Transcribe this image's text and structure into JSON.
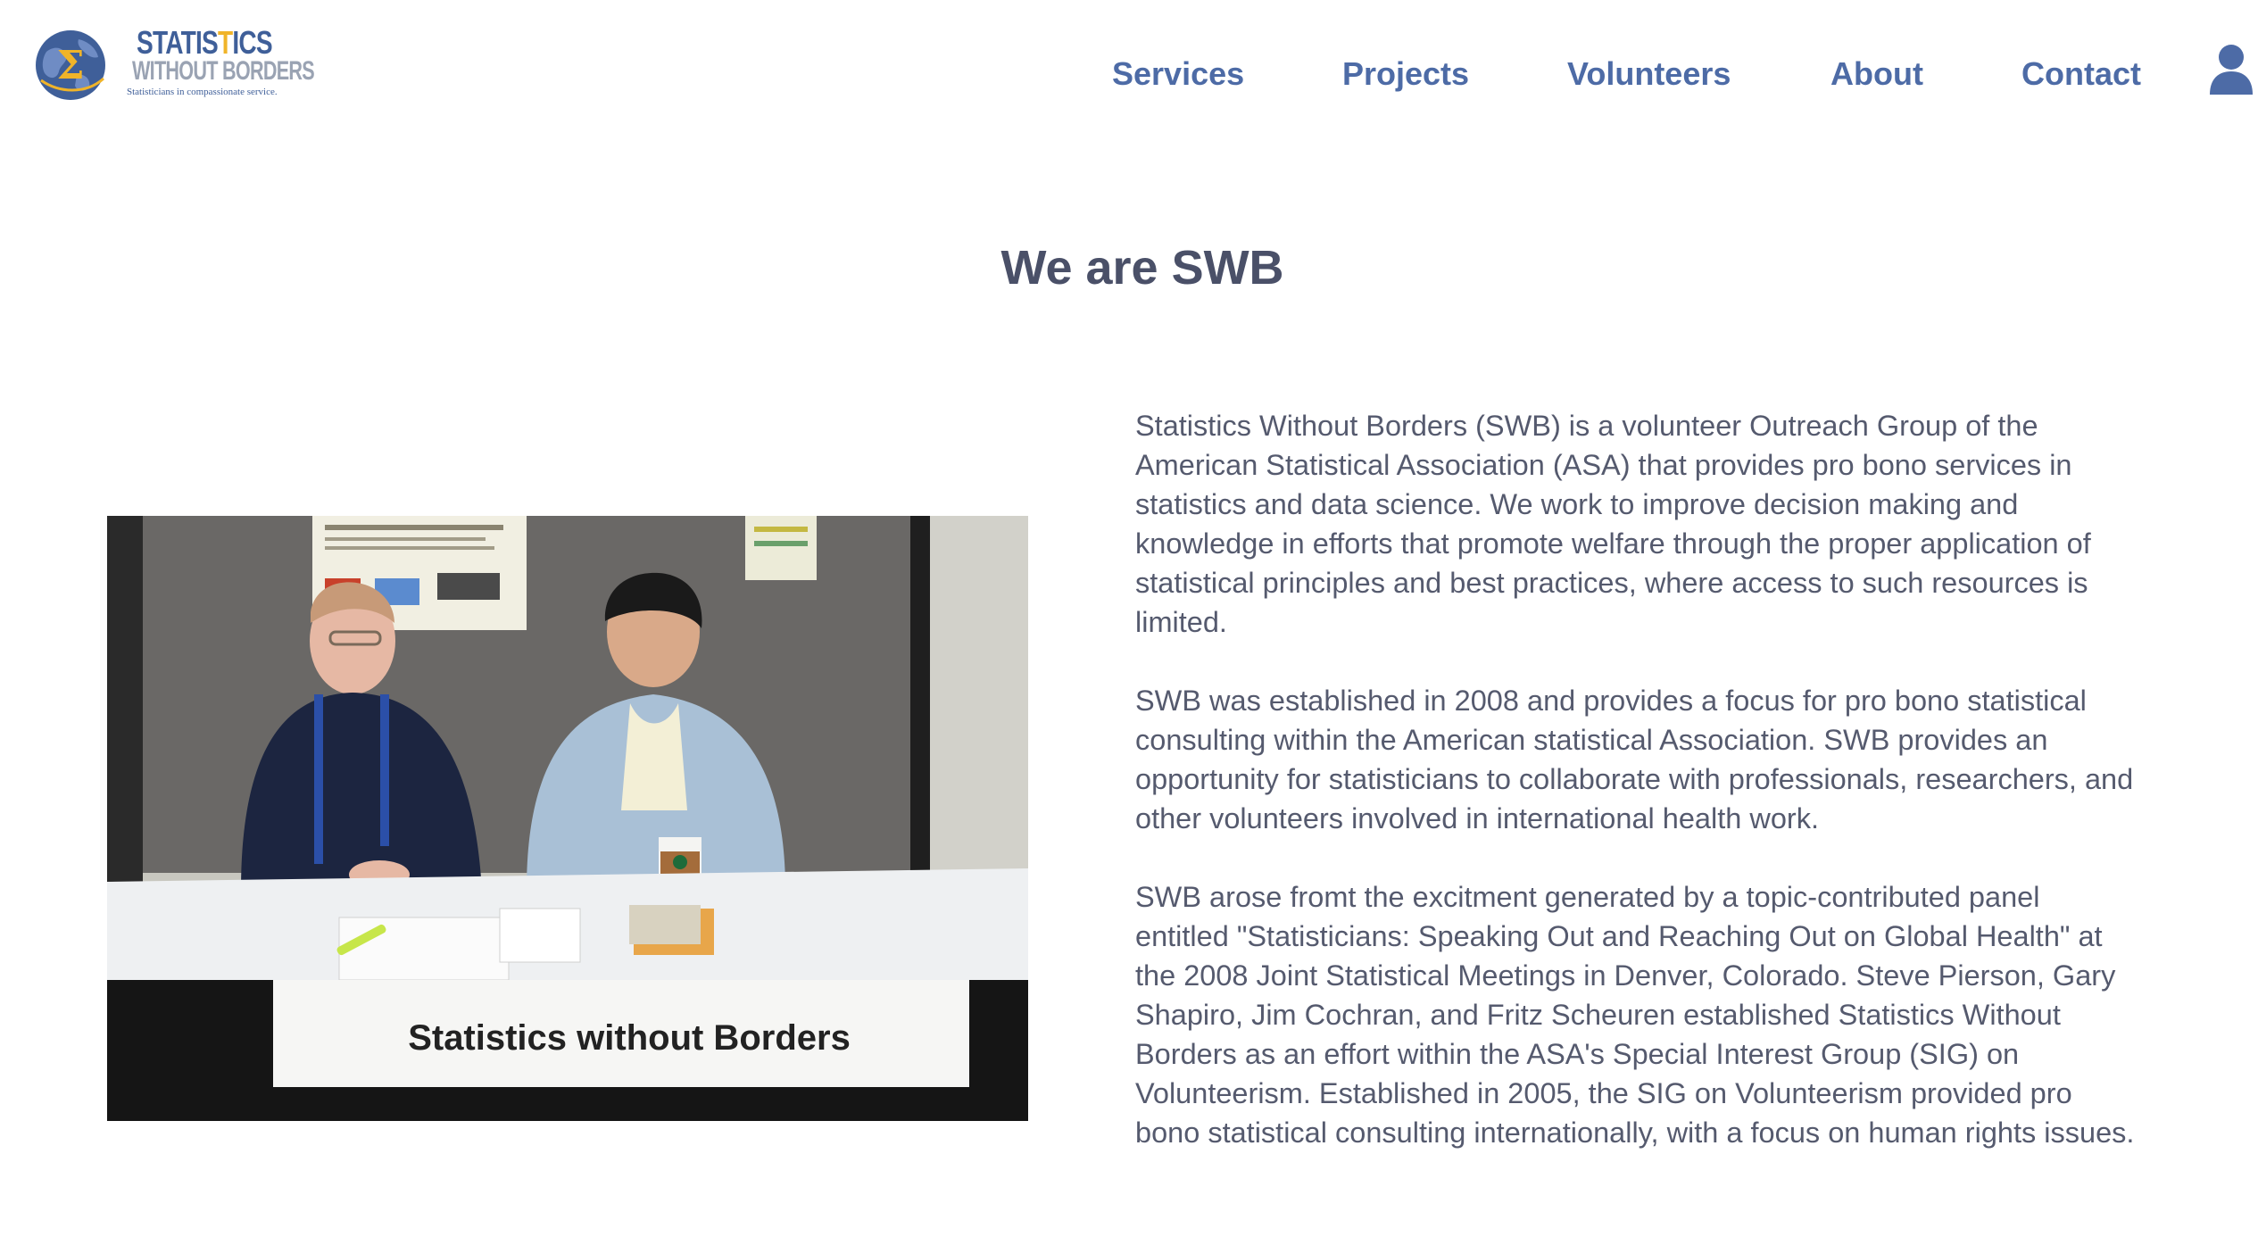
{
  "brand": {
    "name_line1_a": "STATIS",
    "name_line1_accent": "T",
    "name_line1_b": "ICS",
    "name_line2": "WITHOUT BORDERS",
    "tagline": "Statisticians in compassionate service.",
    "colors": {
      "primary": "#3f5f99",
      "accent": "#f0b429",
      "secondary": "#9aa3b3"
    }
  },
  "nav": {
    "items": [
      {
        "label": "Services"
      },
      {
        "label": "Projects"
      },
      {
        "label": "Volunteers"
      },
      {
        "label": "About"
      },
      {
        "label": "Contact"
      }
    ],
    "user_icon": "user-icon",
    "color": "#4d6ba6"
  },
  "main": {
    "title": "We are SWB",
    "photo": {
      "banner_text": "Statistics without Borders"
    },
    "paragraphs": [
      "Statistics Without Borders (SWB) is a volunteer Outreach Group of the American Statistical Association (ASA) that provides pro bono services in statistics and data science. We work to improve decision making and knowledge in efforts that promote welfare through the proper application of statistical principles and best practices, where access to such resources is limited.",
      "SWB was established in 2008 and provides a focus for pro bono statistical consulting within the American statistical Association. SWB provides an opportunity for statisticians to collaborate with professionals, researchers, and other volunteers involved in international health work.",
      "SWB arose fromt the excitment generated by a topic-contributed panel entitled \"Statisticians: Speaking Out and Reaching Out on Global Health\" at the 2008 Joint Statistical Meetings in Denver, Colorado. Steve Pierson, Gary Shapiro, Jim Cochran, and Fritz Scheuren established Statistics Without Borders as an effort within the ASA's Special Interest Group (SIG) on Volunteerism. Established in 2005, the SIG on Volunteerism provided pro bono statistical consulting internationally, with a focus on human rights issues."
    ]
  }
}
